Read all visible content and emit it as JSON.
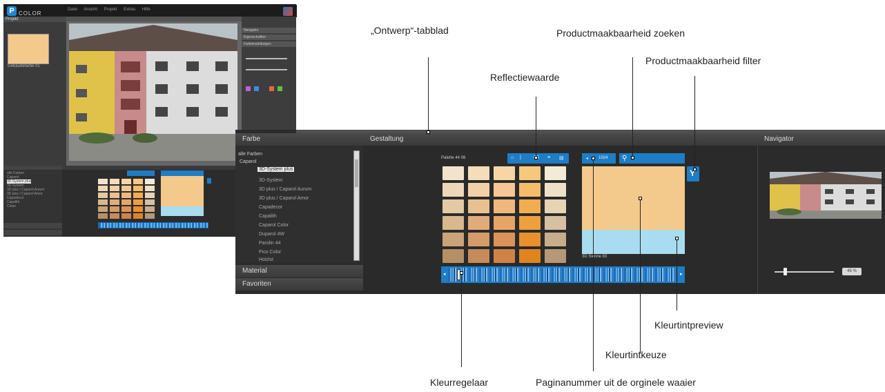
{
  "small_screenshot": {
    "menu_items": [
      "Datei",
      "Ansicht",
      "Projekt",
      "Extras",
      "Hilfe"
    ],
    "left_tab": "Projekt",
    "left_item": "Gebäudefarbe 01",
    "tree_items": [
      "alle Farben",
      "Caparol",
      "3D-System plus",
      "3D-System",
      "3D plus / Caparol Aurum",
      "3D plus / Caparol Amor",
      "Capadecor",
      "Capalith",
      "Clean"
    ],
    "right_headers": [
      "Navigator",
      "Eigenschaften",
      "Farbeinstellungen"
    ]
  },
  "farbe_panel": {
    "title": "Farbe",
    "tree_items": [
      "alle Farben",
      "Caparol",
      "3D-System plus",
      "3D-System",
      "3D plus / Caparol Aurum",
      "3D plus / Caparol Amor",
      "Capadecor",
      "Capalith",
      "Caparol Color",
      "Duparol 4W",
      "Parolin 44",
      "Pico Color",
      "Holzlst"
    ],
    "material_label": "Material",
    "favorites_label": "Favoriten"
  },
  "design_panel": {
    "title": "Gestaltung",
    "fan_label": "Palette 44 08",
    "reflect_value": "68",
    "page_number": "1024",
    "preview_label": "3D Sienne 83",
    "slider_left": "◂",
    "slider_right": "▸",
    "filter_glyph": "Y",
    "search_glyph": "⚲",
    "swatch_colors": [
      [
        "#f3e3cc",
        "#f5dcba",
        "#f6d6a7",
        "#f6c87e",
        "#f4ebd7"
      ],
      [
        "#eed7b8",
        "#f2d1aa",
        "#f4c795",
        "#f5bd6b",
        "#eee1c7"
      ],
      [
        "#e4c9a5",
        "#e9c191",
        "#efb87e",
        "#f2ad52",
        "#e6d4b5"
      ],
      [
        "#d8b88c",
        "#e0ad7a",
        "#e6a566",
        "#ee9f3e",
        "#d6c0a1"
      ],
      [
        "#c9a379",
        "#d49c69",
        "#dc935a",
        "#e8902e",
        "#c8ad8c"
      ],
      [
        "#b68f66",
        "#c68b5a",
        "#cf8346",
        "#e08420",
        "#b69876"
      ]
    ],
    "preview_top_color": "#f4c98c",
    "preview_bottom_color": "#aadcef",
    "accent_color": "#1e7dc4"
  },
  "navigator_panel": {
    "title": "Navigator",
    "zoom_value": "45 %"
  },
  "annotations": {
    "design_tab": "„Ontwerp“-tabblad",
    "product_search": "Productmaakbaarheid zoeken",
    "product_filter": "Productmaakbaarheid filter",
    "reflection_value": "Reflectiewaarde",
    "color_tint_preview": "Kleurtintpreview",
    "color_tint_choice": "Kleurtintkeuze",
    "color_slider": "Kleurregelaar",
    "page_number": "Paginanummer uit de orginele waaier"
  }
}
